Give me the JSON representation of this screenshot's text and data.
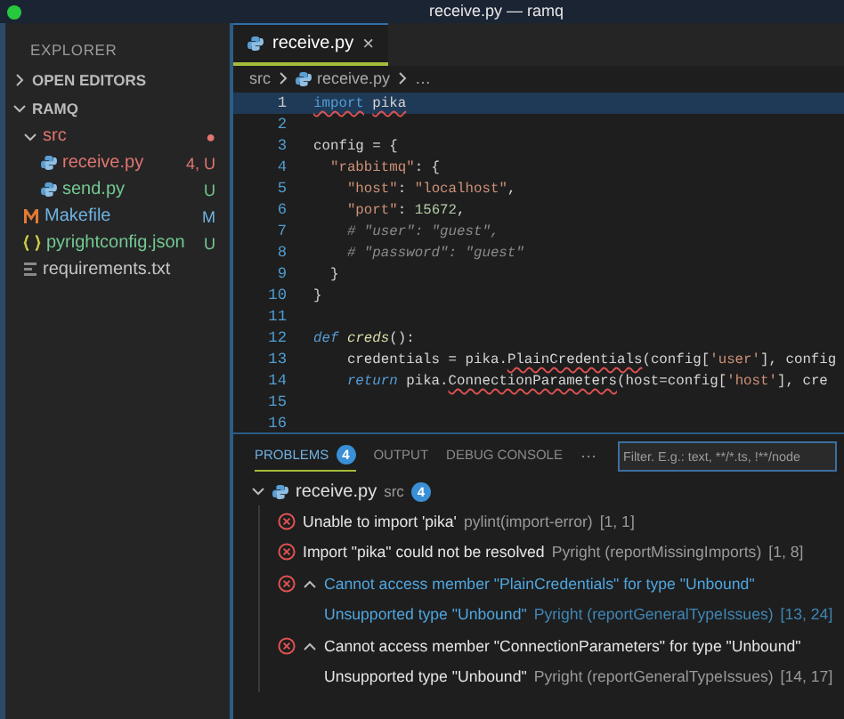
{
  "window": {
    "title": "receive.py — ramq"
  },
  "sidebar": {
    "title": "EXPLORER",
    "sections": [
      {
        "label": "OPEN EDITORS",
        "expanded": false
      },
      {
        "label": "RAMQ",
        "expanded": true
      }
    ],
    "tree": [
      {
        "label": "src",
        "kind": "folder",
        "expanded": true,
        "color": "#e0766f",
        "badge": "●",
        "children": [
          {
            "label": "receive.py",
            "kind": "python",
            "color": "#e0766f",
            "badge": "4, U",
            "selected": false
          },
          {
            "label": "send.py",
            "kind": "python",
            "color": "#73c991",
            "badge": "U",
            "selected": false
          }
        ]
      },
      {
        "label": "Makefile",
        "kind": "makefile",
        "color": "#6fb3e0",
        "badge": "M",
        "selected": false
      },
      {
        "label": "pyrightconfig.json",
        "kind": "json",
        "color": "#73c991",
        "badge": "U",
        "selected": false
      },
      {
        "label": "requirements.txt",
        "kind": "text",
        "color": "#c5c5c5",
        "selected": false
      }
    ]
  },
  "editor": {
    "tabs": [
      {
        "label": "receive.py",
        "selected": true,
        "close": "×"
      }
    ],
    "breadcrumb": [
      "src",
      "receive.py",
      "…"
    ],
    "lines": [
      {
        "number": "1",
        "current": true,
        "tokens": [
          {
            "text": "import",
            "kind": "keyword",
            "error": true
          },
          {
            "text": " pika",
            "kind": "plain",
            "error": true
          }
        ]
      },
      {
        "number": "2",
        "current": false
      },
      {
        "number": "3",
        "current": false,
        "tokens": [
          {
            "text": "config ",
            "kind": "plain"
          },
          {
            "text": "=",
            "kind": "operator"
          },
          {
            "text": " {",
            "kind": "plain"
          }
        ]
      },
      {
        "number": "4",
        "current": false,
        "tokens": [
          {
            "text": "  \"rabbitmq\"",
            "kind": "key"
          },
          {
            "text": ": {",
            "kind": "plain"
          }
        ]
      },
      {
        "number": "5",
        "current": false,
        "tokens": [
          {
            "text": "    \"host\"",
            "kind": "key"
          },
          {
            "text": ": ",
            "kind": "plain"
          },
          {
            "text": "\"localhost\"",
            "kind": "string"
          },
          {
            "text": ",",
            "kind": "plain"
          }
        ]
      },
      {
        "number": "6",
        "current": false,
        "tokens": [
          {
            "text": "    \"port\"",
            "kind": "key"
          },
          {
            "text": ": ",
            "kind": "plain"
          },
          {
            "text": "15672",
            "kind": "number"
          },
          {
            "text": ",",
            "kind": "plain"
          }
        ]
      },
      {
        "number": "7",
        "current": false,
        "tokens": [
          {
            "text": "    # \"user\": \"guest\",",
            "kind": "comment"
          }
        ]
      },
      {
        "number": "8",
        "current": false,
        "tokens": [
          {
            "text": "    # \"password\": \"guest\"",
            "kind": "comment"
          }
        ]
      },
      {
        "number": "9",
        "current": false,
        "tokens": [
          {
            "text": "  }",
            "kind": "plain"
          }
        ]
      },
      {
        "number": "10",
        "current": false,
        "tokens": [
          {
            "text": "}",
            "kind": "plain"
          }
        ]
      },
      {
        "number": "11",
        "current": false
      },
      {
        "number": "12",
        "current": false,
        "tokens": [
          {
            "text": "def",
            "kind": "keyword"
          },
          {
            "text": " creds",
            "kind": "function"
          },
          {
            "text": "():",
            "kind": "plain"
          }
        ]
      },
      {
        "number": "13",
        "current": false,
        "tokens": [
          {
            "text": "    credentials ",
            "kind": "plain"
          },
          {
            "text": "=",
            "kind": "operator"
          },
          {
            "text": " pika.",
            "kind": "plain"
          },
          {
            "text": "PlainCredentials",
            "kind": "plain",
            "error": true
          },
          {
            "text": "(config[",
            "kind": "plain"
          },
          {
            "text": "'user'",
            "kind": "string"
          },
          {
            "text": "], config",
            "kind": "plain"
          }
        ]
      },
      {
        "number": "14",
        "current": false,
        "tokens": [
          {
            "text": "    return",
            "kind": "keyword"
          },
          {
            "text": " pika.",
            "kind": "plain"
          },
          {
            "text": "ConnectionParameters",
            "kind": "plain",
            "error": true
          },
          {
            "text": "(host",
            "kind": "plain"
          },
          {
            "text": "=",
            "kind": "operator"
          },
          {
            "text": "config[",
            "kind": "plain"
          },
          {
            "text": "'host'",
            "kind": "string"
          },
          {
            "text": "], cre",
            "kind": "plain"
          }
        ]
      },
      {
        "number": "15",
        "current": false
      },
      {
        "number": "16",
        "current": false
      }
    ]
  },
  "panel": {
    "tabs": [
      {
        "label": "PROBLEMS",
        "count": "4",
        "selected": true
      },
      {
        "label": "OUTPUT",
        "selected": false
      },
      {
        "label": "DEBUG CONSOLE",
        "selected": false
      }
    ],
    "more": "···",
    "filter": {
      "placeholder": "Filter. E.g.: text, **/*.ts, !**/node"
    },
    "groups": [
      {
        "file": "receive.py",
        "folder": "src",
        "count": "4",
        "expanded": true,
        "problems": [
          {
            "kind": "simple",
            "message": "Unable to import 'pika'",
            "source": "pylint(import-error)",
            "position": "[1, 1]",
            "selected": false
          },
          {
            "kind": "simple",
            "message": "Import \"pika\" could not be resolved",
            "source": "Pyright (reportMissingImports)",
            "position": "[1, 8]",
            "selected": false
          },
          {
            "kind": "expandable",
            "expanded": true,
            "message": "Cannot access member \"PlainCredentials\" for type \"Unbound\"",
            "detail": "Unsupported type \"Unbound\"",
            "source": "Pyright (reportGeneralTypeIssues)",
            "position": "[13, 24]",
            "selected": true
          },
          {
            "kind": "expandable",
            "expanded": true,
            "message": "Cannot access member \"ConnectionParameters\" for type \"Unbound\"",
            "detail": "Unsupported type \"Unbound\"",
            "source": "Pyright (reportGeneralTypeIssues)",
            "position": "[14, 17]",
            "selected": false
          }
        ]
      }
    ]
  }
}
